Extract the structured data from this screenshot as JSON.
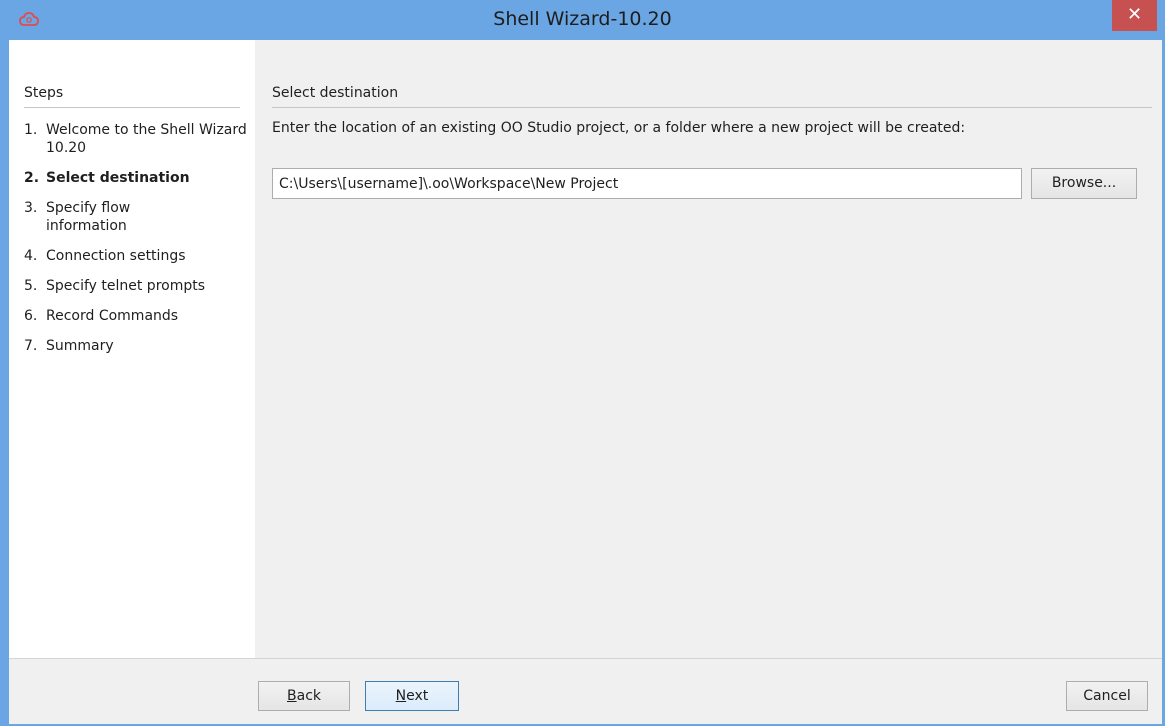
{
  "window": {
    "title": "Shell Wizard-10.20",
    "close_label": "✕"
  },
  "steps": {
    "header": "Steps",
    "items": [
      {
        "num": "1.",
        "label": "Welcome to the Shell Wizard 10.20",
        "active": false
      },
      {
        "num": "2.",
        "label": "Select destination",
        "active": true
      },
      {
        "num": "3.",
        "label": "Specify flow information",
        "active": false
      },
      {
        "num": "4.",
        "label": "Connection settings",
        "active": false
      },
      {
        "num": "5.",
        "label": "Specify telnet prompts",
        "active": false
      },
      {
        "num": "6.",
        "label": "Record Commands",
        "active": false
      },
      {
        "num": "7.",
        "label": "Summary",
        "active": false
      }
    ]
  },
  "main": {
    "section_title": "Select destination",
    "instructions": "Enter the location of an existing OO Studio project, or a folder where a new project will be created:",
    "path_value": "C:\\Users\\[username]\\.oo\\Workspace\\New Project",
    "browse_label": "Browse..."
  },
  "footer": {
    "back_mnemonic": "B",
    "back_rest": "ack",
    "next_mnemonic": "N",
    "next_rest": "ext",
    "cancel_label": "Cancel"
  },
  "colors": {
    "titlebar": "#6aa6e3",
    "close_button": "#c75050",
    "app_icon": "#e04b4b"
  },
  "icons": {
    "app": "cloud-logo-icon",
    "close": "close-icon"
  }
}
